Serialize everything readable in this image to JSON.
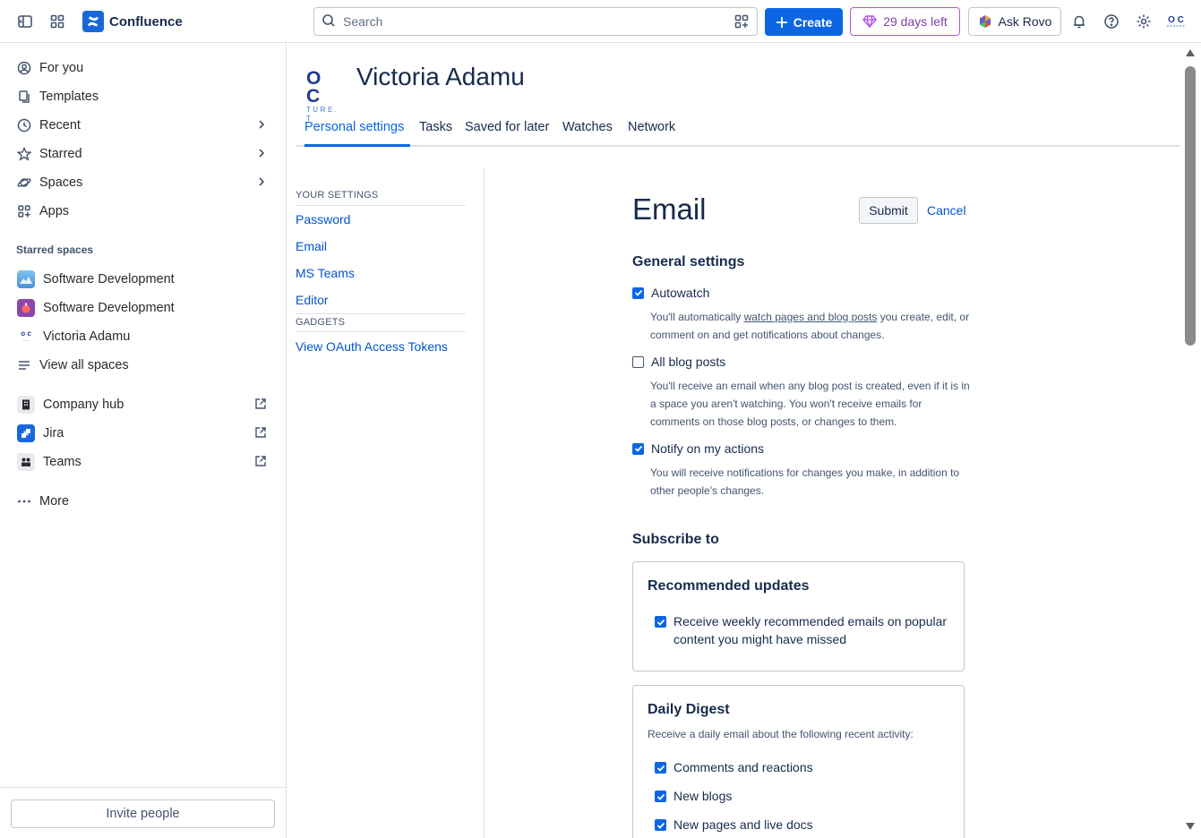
{
  "topbar": {
    "app_name": "Confluence",
    "search_placeholder": "Search",
    "create_label": "Create",
    "trial_label": "29 days left",
    "rovo_label": "Ask Rovo",
    "avatar_text": "O C"
  },
  "sidebar": {
    "nav": [
      {
        "label": "For you"
      },
      {
        "label": "Templates"
      },
      {
        "label": "Recent"
      },
      {
        "label": "Starred"
      },
      {
        "label": "Spaces"
      },
      {
        "label": "Apps"
      }
    ],
    "starred_title": "Starred spaces",
    "starred": [
      {
        "label": "Software Development"
      },
      {
        "label": "Software Development"
      },
      {
        "label": "Victoria Adamu"
      },
      {
        "label": "View all spaces"
      }
    ],
    "links": [
      {
        "label": "Company hub"
      },
      {
        "label": "Jira"
      },
      {
        "label": "Teams"
      }
    ],
    "more_label": "More",
    "invite_label": "Invite people"
  },
  "profile": {
    "name": "Victoria Adamu",
    "logo_text": "O C",
    "logo_subtext": "TURE. T"
  },
  "tabs": [
    {
      "label": "Personal settings"
    },
    {
      "label": "Tasks"
    },
    {
      "label": "Saved for later"
    },
    {
      "label": "Watches"
    },
    {
      "label": "Network"
    }
  ],
  "settings_nav": {
    "your_settings_heading": "YOUR SETTINGS",
    "links": [
      {
        "label": "Password"
      },
      {
        "label": "Email"
      },
      {
        "label": "MS Teams"
      },
      {
        "label": "Editor"
      }
    ],
    "gadgets_heading": "GADGETS",
    "gadget_links": [
      {
        "label": "View OAuth Access Tokens"
      }
    ]
  },
  "email": {
    "title": "Email",
    "submit_label": "Submit",
    "cancel_label": "Cancel",
    "general_heading": "General settings",
    "autowatch": {
      "label": "Autowatch",
      "checked": true,
      "desc_pre": "You'll automatically ",
      "desc_link": "watch pages and blog posts",
      "desc_post": " you create, edit, or comment on and get notifications about changes."
    },
    "all_blog_posts": {
      "label": "All blog posts",
      "checked": false,
      "desc": "You'll receive an email when any blog post is created, even if it is in a space you aren't watching. You won't receive emails for comments on those blog posts, or changes to them."
    },
    "notify_actions": {
      "label": "Notify on my actions",
      "checked": true,
      "desc": "You will receive notifications for changes you make, in addition to other people's changes."
    },
    "subscribe_heading": "Subscribe to",
    "recommended": {
      "title": "Recommended updates",
      "option": "Receive weekly recommended emails on popular content you might have missed",
      "checked": true
    },
    "daily_digest": {
      "title": "Daily Digest",
      "subtitle": "Receive a daily email about the following recent activity:",
      "options": [
        {
          "label": "Comments and reactions",
          "checked": true
        },
        {
          "label": "New blogs",
          "checked": true
        },
        {
          "label": "New pages and live docs",
          "checked": true
        }
      ]
    }
  },
  "colors": {
    "accent": "#0c66e4",
    "link": "#0055cc",
    "trial": "#803fa5"
  }
}
